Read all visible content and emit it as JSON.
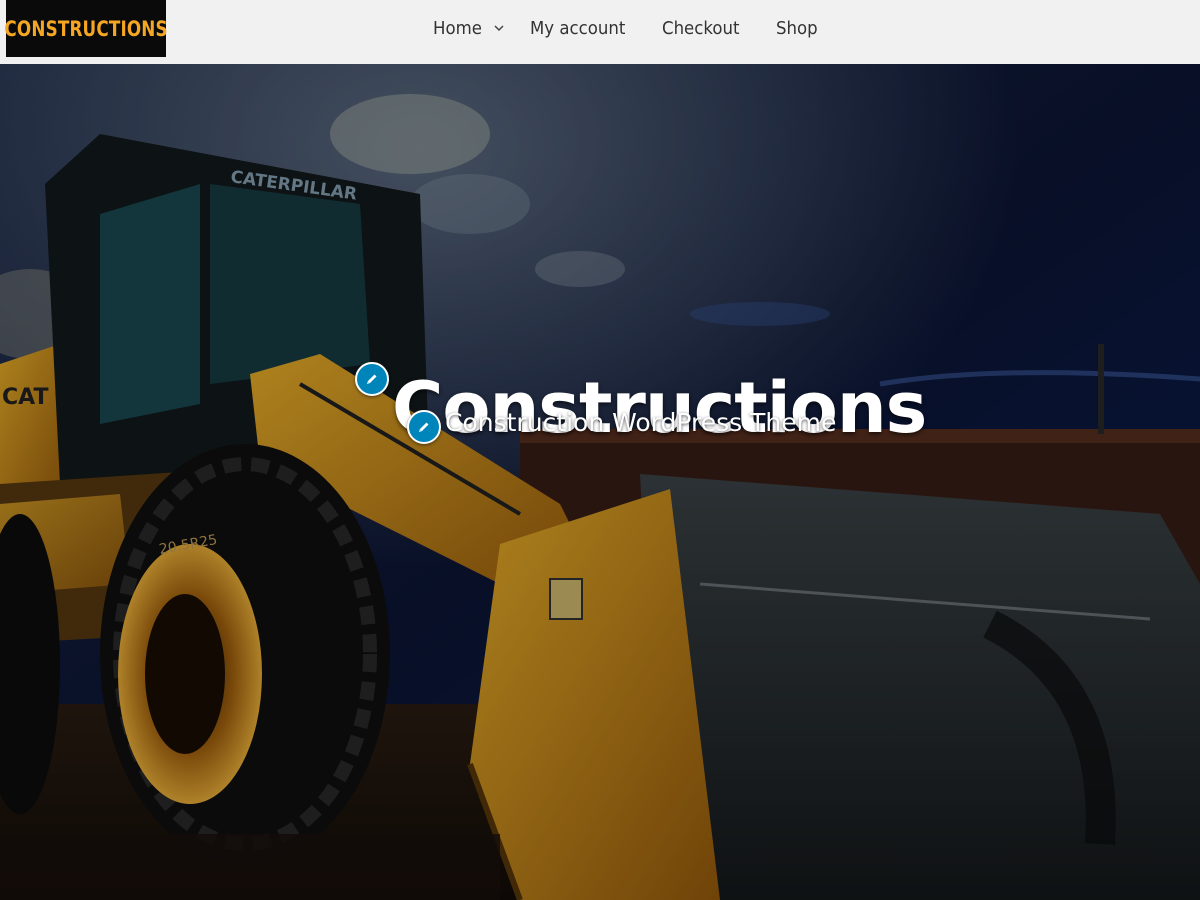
{
  "header": {
    "logo_text": "CONSTRUCTIONS",
    "nav": [
      {
        "label": "Home"
      },
      {
        "label": "My account"
      },
      {
        "label": "Checkout"
      },
      {
        "label": "Shop"
      }
    ],
    "dropdown_icon": "chevron-down-icon"
  },
  "hero": {
    "title": "Constructions",
    "tagline": "Construction WordPress Theme",
    "edit_icon": "pencil-icon",
    "image_text": {
      "cab_brand": "CATERPILLAR",
      "side_brand": "CAT",
      "tire_marking": "20.5R25"
    }
  },
  "colors": {
    "header_bg": "#f1f1f1",
    "logo_bg": "#0a0a0a",
    "logo_text": "#f5a623",
    "nav_text": "#333333",
    "edit_button": "#0085ba",
    "machine_yellow": "#e0a31a",
    "sky": "#0d1a3d"
  }
}
